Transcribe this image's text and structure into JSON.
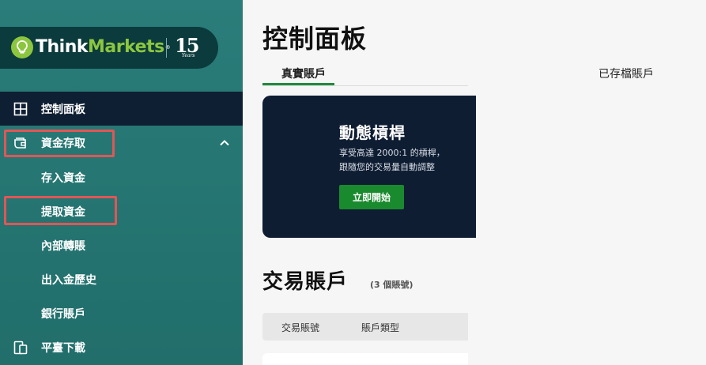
{
  "brand": {
    "name_part1": "Think",
    "name_part2": "Markets",
    "registered": "®",
    "anniversary_number": "15",
    "anniversary_word": "Years"
  },
  "colors": {
    "sidebar_bg": "#2a7d7a",
    "logo_bg": "#0b3b3c",
    "active_nav_bg": "#0f1f33",
    "brand_green": "#8cc63f",
    "highlight": "#e15656",
    "promo_bg": "#0f1d33",
    "button_green": "#1a8a2e"
  },
  "sidebar": {
    "items": [
      {
        "label": "控制面板",
        "icon": "dashboard-grid-icon",
        "active": true
      },
      {
        "label": "資金存取",
        "icon": "wallet-icon",
        "expanded": true
      },
      {
        "label": "平臺下載",
        "icon": "download-devices-icon"
      }
    ],
    "funds_subitems": [
      {
        "label": "存入資金"
      },
      {
        "label": "提取資金"
      },
      {
        "label": "內部轉賬"
      },
      {
        "label": "出入金歷史"
      },
      {
        "label": "銀行賬戶"
      }
    ]
  },
  "main": {
    "title": "控制面板",
    "tabs": [
      {
        "label": "真實賬戶",
        "active": true
      },
      {
        "label": "已存檔賬戶",
        "active": false
      }
    ],
    "promo": {
      "title": "動態槓桿",
      "line1": "享受高達 2000:1 的槓桿，",
      "line2": "跟隨您的交易量自動調整",
      "button": "立即開始"
    },
    "accounts": {
      "title": "交易賬戶",
      "count": "(3 個賬號)",
      "columns": [
        "交易賬號",
        "賬戶類型"
      ]
    }
  }
}
